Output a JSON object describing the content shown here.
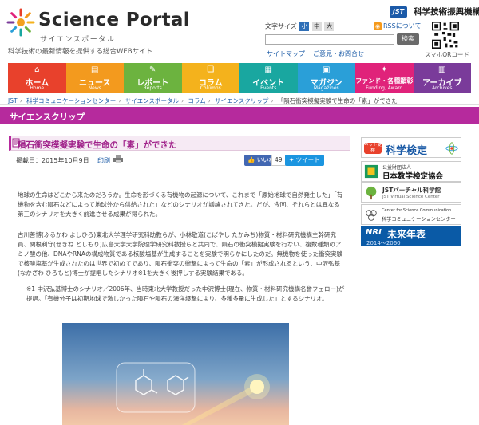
{
  "header": {
    "logo_title": "Science Portal",
    "logo_sub": "サイエンスポータル",
    "tagline": "科学技術の最新情報を提供する総合WEBサイト",
    "jst_mark": "JST",
    "jst_name": "科学技術振興機構",
    "fontsize_label": "文字サイズ",
    "fontsize_options": [
      "小",
      "中",
      "大"
    ],
    "rss_label": "RSSについて",
    "search_placeholder": "",
    "search_button": "検索",
    "sitemap": "サイトマップ",
    "contact": "ご意見・お問合せ",
    "qr_caption": "スマホQRコード"
  },
  "nav": [
    {
      "label": "ホーム",
      "en": "Home",
      "icon": "home-icon",
      "color": "#e8412c"
    },
    {
      "label": "ニュース",
      "en": "News",
      "icon": "news-icon",
      "color": "#f39a1e"
    },
    {
      "label": "レポート",
      "en": "Reports",
      "icon": "report-icon",
      "color": "#6cb33f"
    },
    {
      "label": "コラム",
      "en": "Columns",
      "icon": "column-icon",
      "color": "#f4b21c"
    },
    {
      "label": "イベント",
      "en": "Events",
      "icon": "event-icon",
      "color": "#19a7a0"
    },
    {
      "label": "マガジン",
      "en": "Magazines",
      "icon": "magazine-icon",
      "color": "#2a9fd8"
    },
    {
      "label": "ファンド・各種顕彰",
      "en": "Funding, Award",
      "icon": "fund-icon",
      "color": "#e0227a"
    },
    {
      "label": "アーカイブ",
      "en": "Archives",
      "icon": "archive-icon",
      "color": "#7a3b9a"
    }
  ],
  "breadcrumb": [
    "JST",
    "科学コミュニケーションセンター",
    "サイエンスポータル",
    "コラム",
    "サイエンスクリップ",
    "「隕石衝突模擬実験で生命の「素」ができた"
  ],
  "section_title": "サイエンスクリップ",
  "article": {
    "title": "隕石衝突模擬実験で生命の「素」ができた",
    "date": "掲載日：2015年10月9日",
    "print": "印刷",
    "like": "いいね！",
    "like_count": "49",
    "tweet": "ツイート",
    "p1": "地球の生命はどこから来たのだろうか。生命を形づくる有機物の起源について、これまで「原始地球で自然発生した」「有機物を含む隕石などによって地球外から供給された」などのシナリオが議論されてきた。だが、今回、それらとは異なる第三のシナリオを大きく前進させる成果が得られた。",
    "p2": "古川善博(ふるかわ よしひろ)東北大学理学研究科助教らが、小林敬道(こばやし たかみち)物質・材料研究機構主幹研究員、関根利守(せきね としもり)広島大学大学院理学研究科教授らと共同で、隕石の衝突模擬実験を行ない、複数種類のアミノ酸の他、DNAやRNAの構成物質である核酸塩基が生成することを実験で明らかにしたのだ。無機物を使った衝突実験で核酸塩基が生成されたのは世界で初めてであり、隕石衝突の衝撃によって生命の「素」が形成されるという、中沢弘基(なかざわ ひろもと)博士が提唱したシナリオ※1を大きく後押しする実験結果である。",
    "p3": "※1 中沢弘基博士のシナリオ／2006年、当時東北大学教授だった中沢博士(現在、物質・材料研究機構名誉フェロー)が提唱。「有機分子は初期地球で激しかった隕石や隕石の海洋爆撃により、多種多量に生成した」とするシナリオ。"
  },
  "sidebar": {
    "b1_tag": "ネット受検",
    "b1_title": "科学検定",
    "b2_top": "公益財団法人",
    "b2_title": "日本数学検定協会",
    "b3_title": "JSTバーチャル科学館",
    "b3_sub": "JST Virtual Science Center",
    "b4_en": "Center for Science Communication",
    "b4_title": "科学コミュニケーションセンター",
    "b5_brand": "NRI",
    "b5_title": "未来年表",
    "b5_years": "2014～2060"
  },
  "colors": {
    "section": "#b62a9d",
    "link": "#1a5aa6"
  }
}
